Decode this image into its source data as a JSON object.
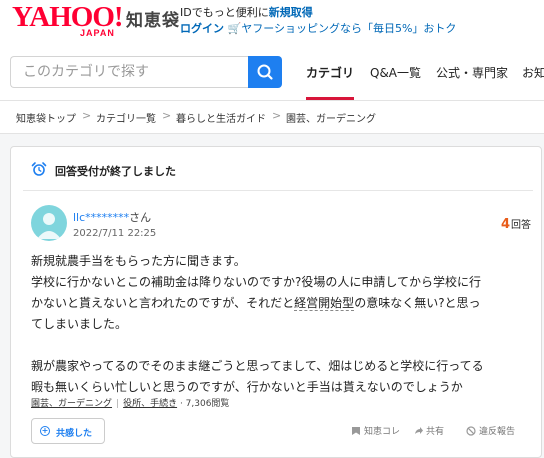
{
  "header": {
    "logo_text": "YAHOO!",
    "logo_sub": "JAPAN",
    "service_name": "知恵袋",
    "promo_line1_pre": "IDでもっと便利に",
    "promo_line1_link": "新規取得",
    "login_label": "ログイン",
    "shopping_promo": "ヤフーショッピングなら「毎日5%」おトク"
  },
  "search": {
    "placeholder": "このカテゴリで探す"
  },
  "tabs": [
    {
      "label": "カテゴリ",
      "active": true
    },
    {
      "label": "Q&A一覧",
      "active": false
    },
    {
      "label": "公式・専門家",
      "active": false
    },
    {
      "label": "お知",
      "active": false
    }
  ],
  "breadcrumb": [
    {
      "label": "知恵袋トップ"
    },
    {
      "label": "カテゴリ一覧"
    },
    {
      "label": "暮らしと生活ガイド"
    },
    {
      "label": "園芸、ガーデニング"
    }
  ],
  "question": {
    "status": "回答受付が終了しました",
    "username": "llc********",
    "honorific": "さん",
    "datetime": "2022/7/11 22:25",
    "answer_count": "4",
    "answer_suffix": "回答",
    "body_lines": [
      "新規就農手当をもらった方に聞きます。",
      "学校に行かないとこの補助金は降りないのですか?役場の人に申請してから学校に行",
      "かないと貰えないと言われたのですが、それだと",
      "経営開始型",
      "の意味なく無い?と思っ",
      "てしまいました。",
      "親が農家やってるのでそのまま継ごうと思ってまして、畑はじめると学校に行ってる",
      "暇も無いくらい忙しいと思うのですが、行かないと手当は貰えないのでしょうか"
    ],
    "category1": "園芸、ガーデニング",
    "category2": "役所、手続き",
    "views": "7,306閲覧",
    "empathy_label": "共感した",
    "actions": {
      "chiekore": "知恵コレ",
      "share": "共有",
      "report": "違反報告"
    }
  },
  "colors": {
    "brand_red": "#ff0033",
    "link_blue": "#1e7ff0",
    "tab_accent": "#d8153a",
    "answer_count": "#e85c1a"
  }
}
